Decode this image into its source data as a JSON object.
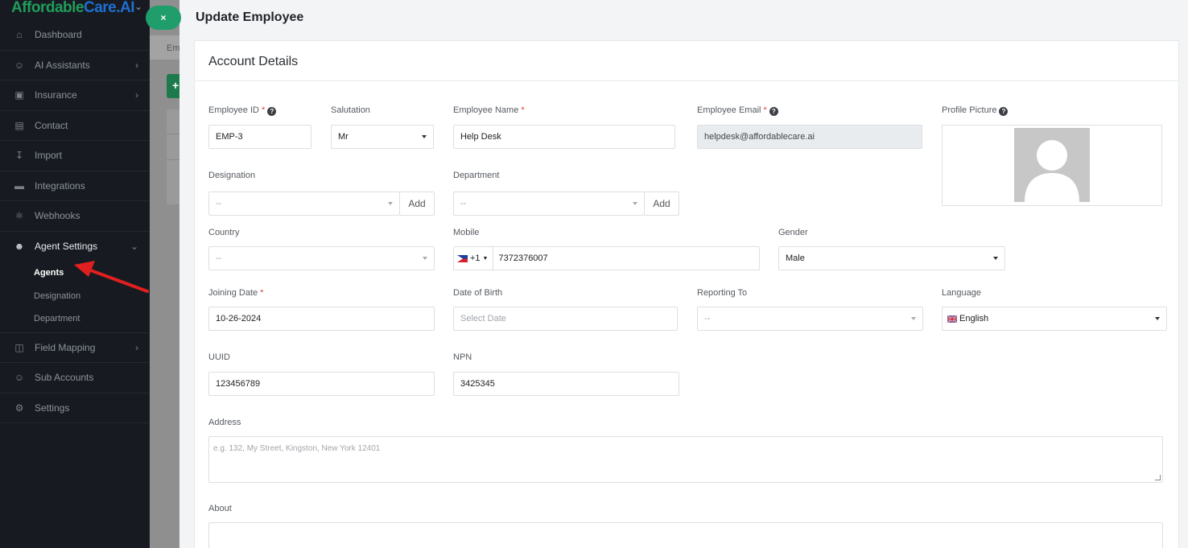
{
  "sidebar": {
    "logo_part1": "Affordable",
    "logo_part2": "Care.AI",
    "items": [
      {
        "label": "Dashboard",
        "icon": "home-icon"
      },
      {
        "label": "AI Assistants",
        "icon": "user-icon"
      },
      {
        "label": "Insurance",
        "icon": "id-card-icon"
      },
      {
        "label": "Contact",
        "icon": "contact-icon"
      },
      {
        "label": "Import",
        "icon": "download-icon"
      },
      {
        "label": "Integrations",
        "icon": "plug-icon"
      },
      {
        "label": "Webhooks",
        "icon": "webhook-icon"
      },
      {
        "label": "Agent Settings",
        "icon": "users-icon"
      },
      {
        "label": "Field Mapping",
        "icon": "database-icon"
      },
      {
        "label": "Sub Accounts",
        "icon": "user-icon"
      },
      {
        "label": "Settings",
        "icon": "gear-icon"
      }
    ],
    "agent_settings_sub": [
      {
        "label": "Agents",
        "active": true
      },
      {
        "label": "Designation"
      },
      {
        "label": "Department"
      }
    ]
  },
  "background": {
    "tab_text": "Em"
  },
  "close_button": "×",
  "panel": {
    "title": "Update Employee",
    "card_title": "Account Details"
  },
  "form": {
    "employee_id": {
      "label": "Employee ID",
      "value": "EMP-3"
    },
    "salutation": {
      "label": "Salutation",
      "value": "Mr"
    },
    "employee_name": {
      "label": "Employee Name",
      "value": "Help Desk"
    },
    "employee_email": {
      "label": "Employee Email",
      "value": "helpdesk@affordablecare.ai"
    },
    "profile_picture": {
      "label": "Profile Picture"
    },
    "designation": {
      "label": "Designation",
      "value": "--",
      "add": "Add"
    },
    "department": {
      "label": "Department",
      "value": "--",
      "add": "Add"
    },
    "country": {
      "label": "Country",
      "value": "--"
    },
    "mobile": {
      "label": "Mobile",
      "code": "+1",
      "value": "7372376007"
    },
    "gender": {
      "label": "Gender",
      "value": "Male"
    },
    "joining_date": {
      "label": "Joining Date",
      "value": "10-26-2024"
    },
    "date_of_birth": {
      "label": "Date of Birth",
      "placeholder": "Select Date"
    },
    "reporting_to": {
      "label": "Reporting To",
      "value": "--"
    },
    "language": {
      "label": "Language",
      "value": "English"
    },
    "uuid": {
      "label": "UUID",
      "value": "123456789"
    },
    "npn": {
      "label": "NPN",
      "value": "3425345"
    },
    "address": {
      "label": "Address",
      "placeholder": "e.g. 132, My Street, Kingston, New York 12401"
    },
    "about": {
      "label": "About"
    }
  },
  "colors": {
    "sidebar_bg": "#171b21",
    "accent_green": "#1f9d6a",
    "required_red": "#e0443b",
    "annotation_arrow": "#e02020"
  }
}
